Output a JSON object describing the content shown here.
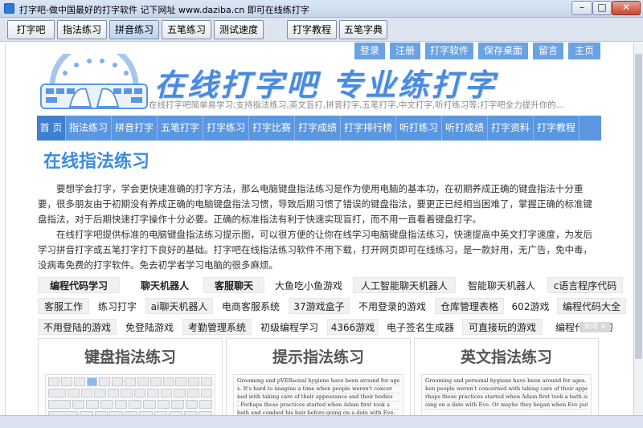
{
  "window": {
    "title": "打字吧-做中国最好的打字软件 记下网址 www.daziba.cn 即可在线练打字",
    "controls": {
      "minimize": "–",
      "maximize": "□",
      "close": "✕"
    }
  },
  "toolbar": {
    "buttons": [
      "打字吧",
      "指法练习",
      "拼音练习",
      "五笔练习",
      "测试速度",
      "打字教程",
      "五笔字典"
    ],
    "active": "拼音练习"
  },
  "site": {
    "title": "在线打字吧  专业练打字",
    "slogan": "在线打字吧简单易学习;支持指法练习,英文盲打,拼音打字,五笔打字,中文打字,听打练习等;打字吧全力提升你的...",
    "top_links": [
      "登录",
      "注册",
      "打字软件",
      "保存桌面",
      "留言",
      "主页"
    ],
    "nav": [
      "首 页",
      "指法练习",
      "拼音打字",
      "五笔打字",
      "打字练习",
      "打字比赛",
      "打字成绩",
      "打字排行榜",
      "听打练习",
      "听打成绩",
      "打字资料",
      "打字教程"
    ]
  },
  "main": {
    "page_title": "在线指法练习",
    "paragraph1": "要想学会打字，学会更快速准确的打字方法，那么电脑键盘指法练习是作为使用电脑的基本功，在初期养成正确的键盘指法十分重要，很多朋友由于初期没有养成正确的电脑键盘指法习惯，导致后期习惯了错误的键盘指法，要更正已经相当困难了，掌握正确的标准键盘指法，对于后期快速打字操作十分必要。正确的标准指法有利于快速实现盲打，而不用一直看着键盘打字。",
    "paragraph2": "在线打字吧提供标准的电脑键盘指法练习提示图，可以很方便的让你在线学习电脑键盘指法练习，快速提高中英文打字速度，为发后学习拼音打字或五笔打字打下良好的基础。打字吧在线指法练习软件不用下载，打开网页即可在线练习，是一款好用，无广告，免中毒，没病毒免费的打字软件。免去初学者学习电脑的很多麻烦。"
  },
  "tags": {
    "row1": [
      "编程代码学习",
      "聊天机器人",
      "客服聊天",
      "大鱼吃小鱼游戏",
      "人工智能聊天机器人",
      "智能聊天机器人",
      "c语言程序代码"
    ],
    "row2": [
      "客服工作",
      "练习打字",
      "ai聊天机器人",
      "电商客服系统",
      "37游戏盒子",
      "不用登录的游戏",
      "仓库管理表格",
      "602游戏",
      "编程代码大全"
    ],
    "row3": [
      "不用登陆的游戏",
      "免登陆游戏",
      "考勤管理系统",
      "初级编程学习",
      "4366游戏",
      "电子签名生成器",
      "可直接玩的游戏",
      "编程代码学习"
    ],
    "ad_close": "关闭 ✕"
  },
  "cards": [
    {
      "title": "键盘指法练习"
    },
    {
      "title": "提示指法练习",
      "sample": [
        "Grooming and pVERsonal hygiene have been around for age",
        "s. It's hard to imagine a time when people weren't concer",
        "ned with taking care of their appearance and their bodies",
        ". Perhaps these practices started when Adam first took a",
        "bath and combed his hair before going on a date with Eve."
      ]
    },
    {
      "title": "英文指法练习",
      "sample": [
        "Grooming and personal hygiene have been around for ages. It's hard to imagine a time w",
        "hen people weren't concerned with taking care of their appearance and their bodies. Pe",
        "rhaps these practices started when Adam first took a bath and combed his hair before g",
        "oing on a date with Eve. Or maybe they began when Eve put on some herbal makeup to mak"
      ]
    }
  ],
  "colors": {
    "accent": "#5b97e0",
    "title": "#4a8be0",
    "toplink": "#6aa2e4"
  }
}
